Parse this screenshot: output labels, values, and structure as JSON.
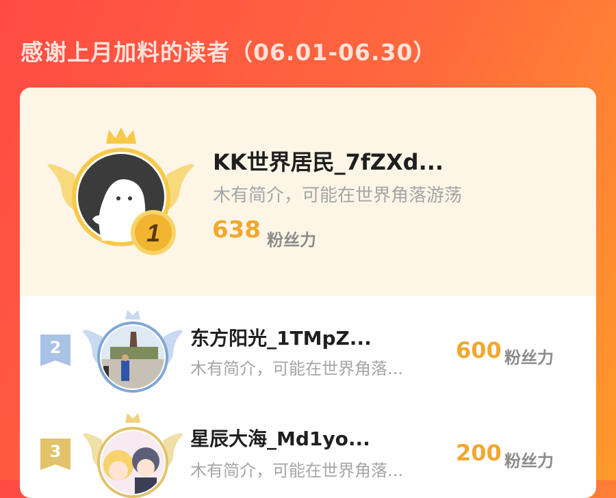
{
  "page": {
    "title": "感谢上月加料的读者（06.01-06.30）"
  },
  "leaders": [
    {
      "rank": "1",
      "name": "KK世界居民_7fZXd...",
      "intro": "木有简介，可能在世界角落游荡",
      "score": "638",
      "unit": "粉丝力",
      "avatar_icon": "ghost-default-avatar-icon"
    },
    {
      "rank": "2",
      "name": "东方阳光_1TMpZ...",
      "intro": "木有简介，可能在世界角落...",
      "score": "600",
      "unit": "粉丝力",
      "avatar_icon": "photo-avatar"
    },
    {
      "rank": "3",
      "name": "星辰大海_Md1yo...",
      "intro": "木有简介，可能在世界角落...",
      "score": "200",
      "unit": "粉丝力",
      "avatar_icon": "anime-avatar"
    }
  ],
  "colors": {
    "accent": "#f2a72e",
    "gold": "#f7c948",
    "silver": "#a9c3e6",
    "bronze": "#e2c26b",
    "header_gradient": [
      "#ff4a44",
      "#ff9a2a"
    ]
  }
}
